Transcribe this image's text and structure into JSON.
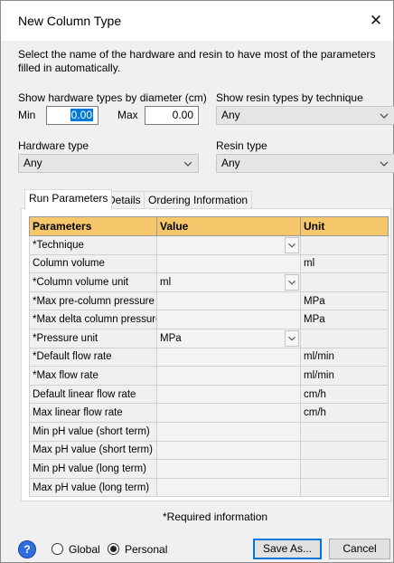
{
  "window": {
    "title": "New Column Type",
    "close_glyph": "✕"
  },
  "intro_text": "Select the name of the hardware and resin to have most of the parameters filled in automatically.",
  "diameter": {
    "label": "Show hardware types by diameter (cm)",
    "min_label": "Min",
    "min_value": "0.00",
    "max_label": "Max",
    "max_value": "0.00"
  },
  "resin_technique": {
    "label": "Show resin types by technique",
    "value": "Any"
  },
  "hardware_type": {
    "label": "Hardware type",
    "value": "Any"
  },
  "resin_type": {
    "label": "Resin type",
    "value": "Any"
  },
  "tabs": [
    {
      "label": "Run Parameters"
    },
    {
      "label": "Details"
    },
    {
      "label": "Ordering Information"
    }
  ],
  "grid": {
    "headers": [
      "Parameters",
      "Value",
      "Unit"
    ],
    "rows": [
      {
        "param": "*Technique",
        "value": "",
        "unit": ""
      },
      {
        "param": "Column volume",
        "value": "",
        "unit": "ml"
      },
      {
        "param": "*Column volume unit",
        "value": "ml",
        "unit": ""
      },
      {
        "param": "*Max pre-column pressure",
        "value": "",
        "unit": "MPa"
      },
      {
        "param": "*Max delta column pressure",
        "value": "",
        "unit": "MPa"
      },
      {
        "param": "*Pressure unit",
        "value": "MPa",
        "unit": ""
      },
      {
        "param": "*Default flow rate",
        "value": "",
        "unit": "ml/min"
      },
      {
        "param": "*Max flow rate",
        "value": "",
        "unit": "ml/min"
      },
      {
        "param": "Default linear flow rate",
        "value": "",
        "unit": "cm/h"
      },
      {
        "param": "Max linear flow rate",
        "value": "",
        "unit": "cm/h"
      },
      {
        "param": "Min pH value (short term)",
        "value": "",
        "unit": ""
      },
      {
        "param": "Max pH value (short term)",
        "value": "",
        "unit": ""
      },
      {
        "param": "Min pH value (long term)",
        "value": "",
        "unit": ""
      },
      {
        "param": "Max pH value (long term)",
        "value": "",
        "unit": ""
      }
    ]
  },
  "required_note": "*Required information",
  "footer": {
    "help_glyph": "?",
    "radio_global": "Global",
    "radio_personal": "Personal",
    "save_as": "Save As...",
    "cancel": "Cancel"
  },
  "colors": {
    "header_bg": "#f5c66a",
    "accent": "#0078d7",
    "help_icon": "#2e6fe0"
  }
}
